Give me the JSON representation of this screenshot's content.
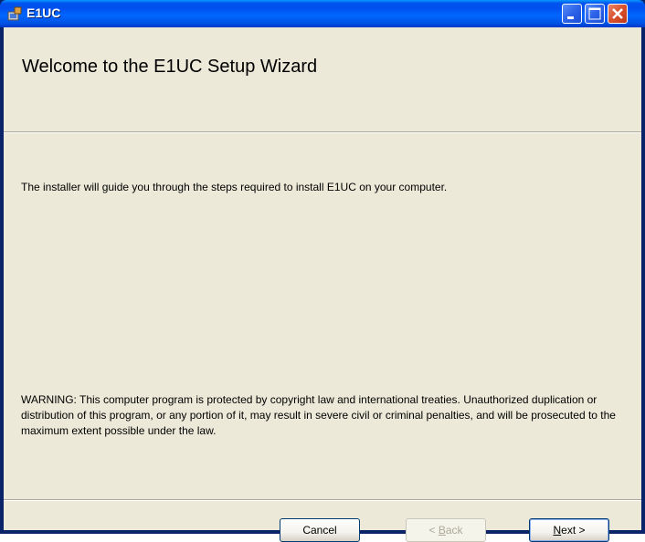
{
  "window": {
    "title": "E1UC"
  },
  "banner": {
    "heading": "Welcome to the E1UC Setup Wizard"
  },
  "body": {
    "intro": "The installer will guide you through the steps required to install E1UC on your computer.",
    "warning": "WARNING: This computer program is protected by copyright law and international treaties. Unauthorized duplication or distribution of this program, or any portion of it, may result in severe civil or criminal penalties, and will be prosecuted to the maximum extent possible under the law."
  },
  "buttons": {
    "cancel": "Cancel",
    "back_prefix": "< ",
    "back_accel": "B",
    "back_rest": "ack",
    "next_accel": "N",
    "next_rest": "ext >"
  },
  "colors": {
    "titlebar": "#0053ee",
    "client": "#ece9d8",
    "close": "#d8502b"
  }
}
